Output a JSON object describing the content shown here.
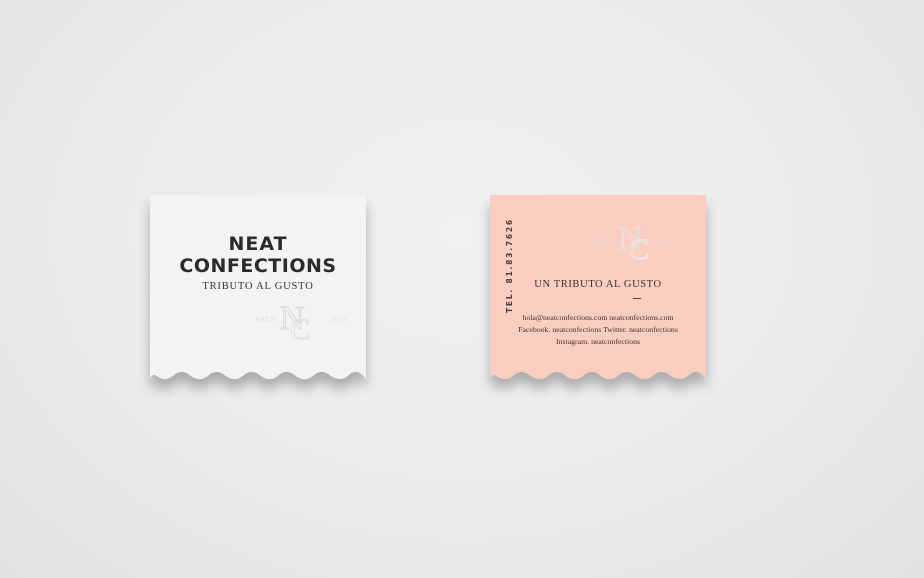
{
  "scene": {
    "background_color": "#ebebeb",
    "front_card_color": "#f3f3f3",
    "back_card_color": "#f9cdbf",
    "foil_color": "#d9d9d9"
  },
  "front_card": {
    "title_line1": "NEAT",
    "title_line2": "CONFECTIONS",
    "subtitle": "TRIBUTO AL GUSTO",
    "estd_label": "ESTD",
    "year_label": "2013",
    "monogram": "NC"
  },
  "back_card": {
    "vertical_text": "TEL. 81.83.7626",
    "estd_label": "ESTD",
    "year_label": "2013",
    "monogram": "NC",
    "tagline": "UN TRIBUTO AL GUSTO",
    "contact_line1": "hola@neatconfections.com   neatconfections.com",
    "contact_line2": "Facebook. neatconfections   Twitter. neatconfections",
    "contact_line3": "Instagram. neatconfections"
  }
}
